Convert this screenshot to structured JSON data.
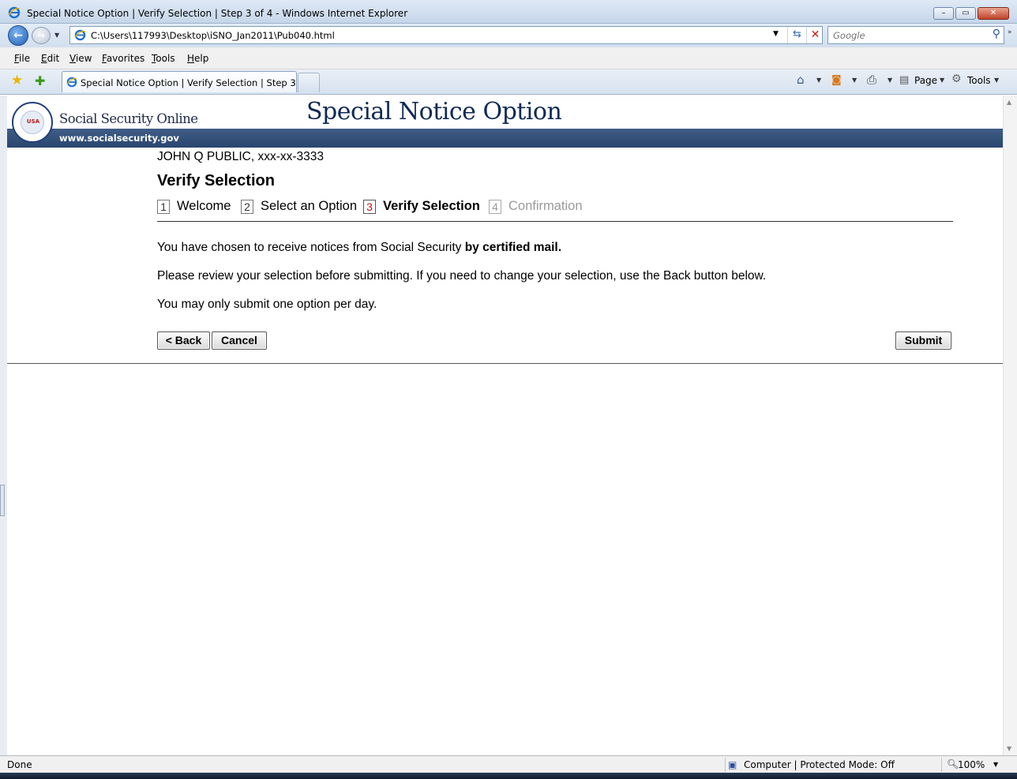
{
  "window": {
    "title": "Special Notice Option | Verify Selection | Step 3 of 4 - Windows Internet Explorer",
    "controls": [
      "–",
      "▭",
      "✕"
    ]
  },
  "address_bar": {
    "url": "C:\\Users\\117993\\Desktop\\iSNO_Jan2011\\Pub040.html",
    "search_placeholder": "Google"
  },
  "menu": {
    "items": [
      "File",
      "Edit",
      "View",
      "Favorites",
      "Tools",
      "Help"
    ]
  },
  "tabs": {
    "active_label": "Special Notice Option | Verify Selection | Step 3 of 4"
  },
  "command_bar": {
    "page_label": "Page",
    "tools_label": "Tools"
  },
  "site": {
    "brand": "Social Security Online",
    "url_text": "www.socialsecurity.gov",
    "banner_title": "Special Notice Option",
    "seal_text": "USA"
  },
  "main": {
    "user_line": "JOHN Q PUBLIC, xxx-xx-3333",
    "heading": "Verify Selection",
    "steps": [
      {
        "num": "1",
        "label": "Welcome",
        "state": "done"
      },
      {
        "num": "2",
        "label": "Select an Option",
        "state": "done"
      },
      {
        "num": "3",
        "label": "Verify Selection",
        "state": "current"
      },
      {
        "num": "4",
        "label": "Confirmation",
        "state": "future"
      }
    ],
    "para1_prefix": "You have chosen to receive notices from Social Security ",
    "para1_bold": "by certified mail.",
    "para2": "Please review your selection before submitting. If you need to change your selection, use the Back button below.",
    "para3": "You may only submit one option per day.",
    "back_label": "< Back",
    "cancel_label": "Cancel",
    "submit_label": "Submit"
  },
  "status_bar": {
    "status": "Done",
    "zone": "Computer | Protected Mode: Off",
    "zoom": "100%"
  },
  "colors": {
    "banner_blue": "#2a4670",
    "title_navy": "#0f2a55",
    "current_step_red": "#c01010"
  }
}
